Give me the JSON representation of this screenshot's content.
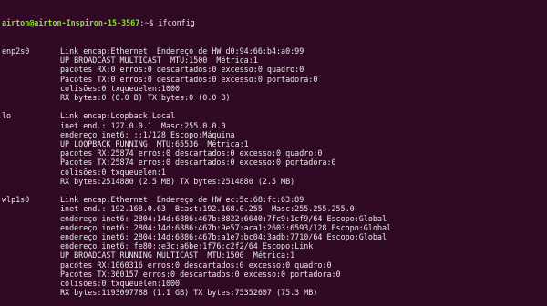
{
  "prompt": {
    "user_host": "airton@airton-Inspiron-15-3567",
    "separator": ":",
    "path": "~",
    "symbol": "$",
    "command": "ifconfig"
  },
  "interfaces": [
    {
      "name": "enp2s0",
      "lines": [
        "Link encap:Ethernet  Endereço de HW d0:94:66:b4:a0:99",
        "UP BROADCAST MULTICAST  MTU:1500  Métrica:1",
        "pacotes RX:0 erros:0 descartados:0 excesso:0 quadro:0",
        "Pacotes TX:0 erros:0 descartados:0 excesso:0 portadora:0",
        "colisões:0 txqueuelen:1000",
        "RX bytes:0 (0.0 B) TX bytes:0 (0.0 B)"
      ]
    },
    {
      "name": "lo",
      "lines": [
        "Link encap:Loopback Local",
        "inet end.: 127.0.0.1  Masc:255.0.0.0",
        "endereço inet6: ::1/128 Escopo:Máquina",
        "UP LOOPBACK RUNNING  MTU:65536  Métrica:1",
        "pacotes RX:25874 erros:0 descartados:0 excesso:0 quadro:0",
        "Pacotes TX:25874 erros:0 descartados:0 excesso:0 portadora:0",
        "colisões:0 txqueuelen:1",
        "RX bytes:2514880 (2.5 MB) TX bytes:2514880 (2.5 MB)"
      ]
    },
    {
      "name": "wlp1s0",
      "lines": [
        "Link encap:Ethernet  Endereço de HW ec:5c:68:fc:63:89",
        "inet end.: 192.168.0.63  Bcast:192.168.0.255  Masc:255.255.255.0",
        "endereço inet6: 2804:14d:6886:467b:8822:6640:7fc9:1cf9/64 Escopo:Global",
        "endereço inet6: 2804:14d:6886:467b:9e57:aca1:2603:6593/128 Escopo:Global",
        "endereço inet6: 2804:14d:6886:467b:a1e7:bc04:3adb:7710/64 Escopo:Global",
        "endereço inet6: fe80::e3c:a6be:1f76:c2f2/64 Escopo:Link",
        "UP BROADCAST RUNNING MULTICAST  MTU:1500  Métrica:1",
        "pacotes RX:1060316 erros:0 descartados:0 excesso:0 quadro:0",
        "Pacotes TX:360157 erros:0 descartados:0 excesso:0 portadora:0",
        "colisões:0 txqueuelen:1000",
        "RX bytes:1193097788 (1.1 GB) TX bytes:75352607 (75.3 MB)"
      ]
    }
  ]
}
